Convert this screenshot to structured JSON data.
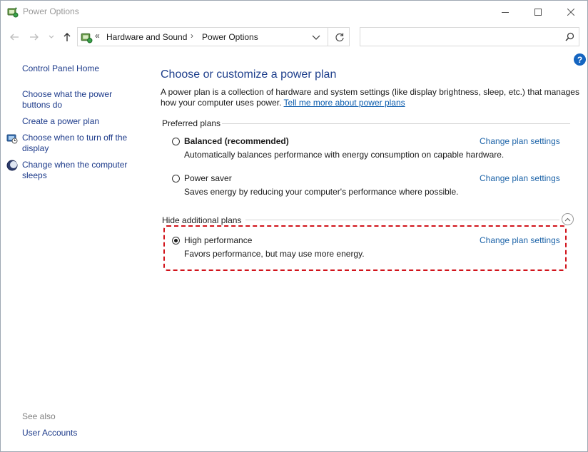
{
  "window": {
    "title": "Power Options",
    "icon": "power-options-icon"
  },
  "navigation": {
    "breadcrumb_chevron": "«",
    "crumbs": [
      "Hardware and Sound",
      "Power Options"
    ],
    "separator": "›",
    "search_placeholder": ""
  },
  "sidebar": {
    "home": "Control Panel Home",
    "links": [
      {
        "label": "Choose what the power buttons do",
        "icon": null
      },
      {
        "label": "Create a power plan",
        "icon": null
      },
      {
        "label": "Choose when to turn off the display",
        "icon": "monitor-clock-icon"
      },
      {
        "label": "Change when the computer sleeps",
        "icon": "moon-icon"
      }
    ],
    "see_also_label": "See also",
    "see_also_links": [
      "User Accounts"
    ]
  },
  "main": {
    "title": "Choose or customize a power plan",
    "intro_text": "A power plan is a collection of hardware and system settings (like display brightness, sleep, etc.) that manages how your computer uses power.",
    "intro_link": "Tell me more about power plans",
    "preferred_label": "Preferred plans",
    "preferred_plans": [
      {
        "name": "Balanced (recommended)",
        "description": "Automatically balances performance with energy consumption on capable hardware.",
        "link": "Change plan settings",
        "selected": false,
        "bold": true
      },
      {
        "name": "Power saver",
        "description": "Saves energy by reducing your computer's performance where possible.",
        "link": "Change plan settings",
        "selected": false,
        "bold": false
      }
    ],
    "additional_label": "Hide additional plans",
    "additional_plans": [
      {
        "name": "High performance",
        "description": "Favors performance, but may use more energy.",
        "link": "Change plan settings",
        "selected": true,
        "bold": false
      }
    ]
  },
  "colors": {
    "link": "#1c63a8",
    "title": "#1e3f8c",
    "highlight": "#d1121a",
    "help": "#1565c0"
  }
}
